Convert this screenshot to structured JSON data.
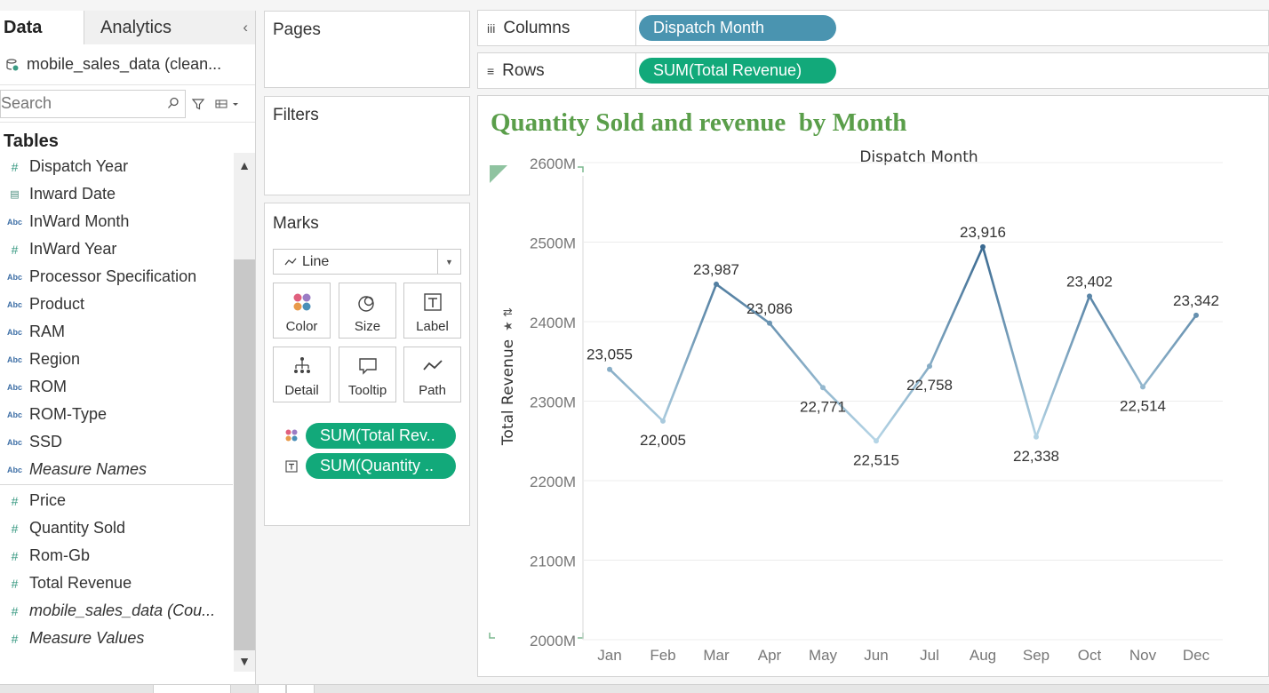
{
  "data_pane": {
    "tab_data": "Data",
    "tab_analytics": "Analytics",
    "collapse_icon": "chevron-left-icon",
    "source": "mobile_sales_data (clean...",
    "search_placeholder": "Search",
    "tables_header": "Tables",
    "dimensions": [
      {
        "type": "#",
        "name": "Dispatch Year"
      },
      {
        "type": "date",
        "name": "Inward Date"
      },
      {
        "type": "Abc",
        "name": "InWard Month"
      },
      {
        "type": "#",
        "name": "InWard Year"
      },
      {
        "type": "Abc",
        "name": "Processor Specification"
      },
      {
        "type": "Abc",
        "name": "Product"
      },
      {
        "type": "Abc",
        "name": "RAM"
      },
      {
        "type": "Abc",
        "name": "Region"
      },
      {
        "type": "Abc",
        "name": "ROM"
      },
      {
        "type": "Abc",
        "name": "ROM-Type"
      },
      {
        "type": "Abc",
        "name": "SSD"
      },
      {
        "type": "Abc",
        "name": "Measure Names"
      }
    ],
    "measures": [
      {
        "type": "#",
        "name": "Price"
      },
      {
        "type": "#",
        "name": "Quantity Sold"
      },
      {
        "type": "#",
        "name": "Rom-Gb"
      },
      {
        "type": "#",
        "name": "Total Revenue"
      },
      {
        "type": "#",
        "name": "mobile_sales_data (Cou..."
      },
      {
        "type": "#",
        "name": "Measure Values"
      }
    ]
  },
  "pages": {
    "title": "Pages"
  },
  "filters": {
    "title": "Filters"
  },
  "marks": {
    "title": "Marks",
    "type": "Line",
    "buttons": [
      "Color",
      "Size",
      "Label",
      "Detail",
      "Tooltip",
      "Path"
    ],
    "pills": [
      "SUM(Total Rev..",
      "SUM(Quantity .."
    ]
  },
  "shelves": {
    "columns_label": "Columns",
    "rows_label": "Rows",
    "columns_pill": "Dispatch Month",
    "rows_pill": "SUM(Total Revenue)"
  },
  "colors": {
    "pill_green": "#12a97a",
    "pill_blue": "#4a94b0",
    "title_green": "#5a9e4a",
    "line_dark": "#3b6a91",
    "line_light": "#a9cce0"
  },
  "chart_data": {
    "type": "line",
    "title": "Quantity Sold and revenue  by Month",
    "xlabel": "Dispatch Month",
    "ylabel": "Total Revenue",
    "categories": [
      "Jan",
      "Feb",
      "Mar",
      "Apr",
      "May",
      "Jun",
      "Jul",
      "Aug",
      "Sep",
      "Oct",
      "Nov",
      "Dec"
    ],
    "y_ticks": [
      "2000M",
      "2100M",
      "2200M",
      "2300M",
      "2400M",
      "2500M",
      "2600M"
    ],
    "ylim": [
      2000,
      2600
    ],
    "y_unit": "M",
    "values": [
      2340,
      2275,
      2447,
      2398,
      2317,
      2250,
      2344,
      2494,
      2255,
      2432,
      2318,
      2408
    ],
    "labels": [
      "23,055",
      "22,005",
      "23,987",
      "23,086",
      "22,771",
      "22,515",
      "22,758",
      "23,916",
      "22,338",
      "23,402",
      "22,514",
      "23,342"
    ],
    "label_field": "Quantity Sold",
    "label_positions": [
      "above",
      "below",
      "above",
      "above",
      "below",
      "below",
      "below",
      "above",
      "below",
      "above",
      "below",
      "above"
    ],
    "grid": true
  }
}
